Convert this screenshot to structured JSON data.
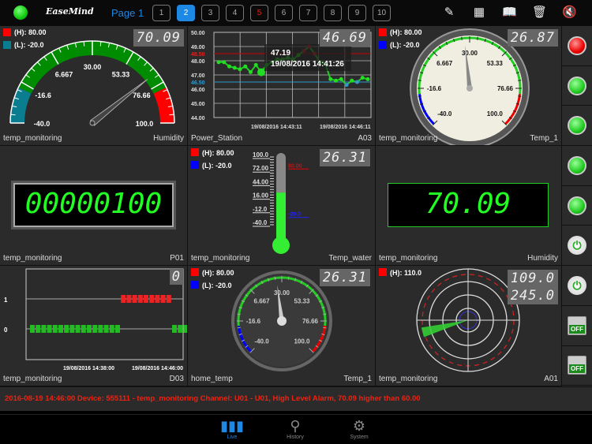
{
  "topbar": {
    "logo": "EaseMind",
    "page_label": "Page 1",
    "pages": [
      "1",
      "2",
      "3",
      "4",
      "5",
      "6",
      "7",
      "8",
      "9",
      "10"
    ],
    "active_page": "2",
    "alarm_page": "5",
    "tools": [
      "edit-icon",
      "grid-icon",
      "book-icon",
      "trash-icon",
      "mute-icon"
    ]
  },
  "panels": {
    "humidity_gauge": {
      "high": "(H): 80.00",
      "low": "(L): -20.0",
      "value": "70.09",
      "ticks": [
        "-40.0",
        "-16.6",
        "6.667",
        "30.00",
        "53.33",
        "76.66",
        "100.0"
      ],
      "device": "temp_monitoring",
      "channel": "Humidity",
      "reading": 70.09,
      "min": -40,
      "max": 100
    },
    "power_chart": {
      "value": "46.69",
      "device": "Power_Station",
      "channel": "A03",
      "tooltip_value": "47.19",
      "tooltip_time": "19/08/2016 14:41:26"
    },
    "temp1_dial": {
      "high": "(H): 80.00",
      "low": "(L): -20.0",
      "value": "26.87",
      "ticks": [
        "-40.0",
        "-16.6",
        "6.667",
        "30.00",
        "53.33",
        "76.66",
        "100.0"
      ],
      "device": "temp_monitoring",
      "channel": "Temp_1",
      "reading": 26.87
    },
    "p01_counter": {
      "display": "00000100",
      "device": "temp_monitoring",
      "channel": "P01"
    },
    "thermometer": {
      "high": "(H): 80.00",
      "low": "(L): -20.0",
      "value": "26.31",
      "scale": [
        "100.0",
        "72.00",
        "44.00",
        "16.00",
        "-12.0",
        "-40.0"
      ],
      "high_mark": "80.00",
      "low_mark": "-20.0",
      "device": "temp_monitoring",
      "channel": "Temp_water",
      "reading": 26.31
    },
    "humidity_display": {
      "display": "70.09",
      "device": "temp_monitoring",
      "channel": "Humidity"
    },
    "d03_chart": {
      "value": "0",
      "y_labels": [
        "1",
        "0"
      ],
      "x_labels": [
        "19/08/2016 14:38:00",
        "19/08/2016 14:46:00"
      ],
      "device": "temp_monitoring",
      "channel": "D03"
    },
    "temp1_dark_dial": {
      "high": "(H): 80.00",
      "low": "(L): -20.0",
      "value": "26.31",
      "ticks": [
        "-40.0",
        "-16.6",
        "6.667",
        "30.00",
        "53.33",
        "76.66",
        "100.0"
      ],
      "device": "home_temp",
      "channel": "Temp_1",
      "reading": 26.31
    },
    "radar": {
      "high": "(H): 110.0",
      "value1": "109.0",
      "value2": "245.0",
      "device": "temp_monitoring",
      "channel": "A01",
      "direction_deg": 245
    }
  },
  "chart_data": [
    {
      "type": "line",
      "title": "Power_Station A03",
      "ylim": [
        44,
        50
      ],
      "yticks": [
        "50.00",
        "49.00",
        "48.50",
        "48.00",
        "47.00",
        "46.50",
        "46.00",
        "45.00",
        "44.00"
      ],
      "high_limit": 48.5,
      "low_limit": 46.5,
      "x_labels": [
        "19/08/2016 14:43:11",
        "19/08/2016 14:46:11"
      ],
      "values": [
        47.9,
        47.9,
        47.6,
        47.5,
        47.4,
        47.6,
        47.2,
        47.7,
        47.19,
        47.7,
        47.9,
        48.1,
        48.1,
        48.2,
        48.1,
        48.4,
        48.7,
        49.0,
        48.5,
        47.9,
        47.8,
        46.7,
        46.6,
        46.7,
        46.3,
        46.6,
        46.5,
        46.8,
        46.7
      ]
    },
    {
      "type": "scatter",
      "title": "D03 digital",
      "ylim": [
        0,
        1
      ],
      "values": [
        0,
        0,
        0,
        0,
        0,
        0,
        0,
        0,
        0,
        0,
        0,
        0,
        0,
        0,
        0,
        0,
        1,
        1,
        1,
        1,
        1,
        1,
        1,
        1,
        1,
        0,
        0,
        0
      ]
    }
  ],
  "side_buttons": [
    "red",
    "green",
    "green",
    "green",
    "green",
    "power",
    "power",
    "off",
    "off"
  ],
  "off_label": "OFF",
  "alarm": "2016-08-19 14:46:00 Device: 555111 - temp_monitoring   Channel: U01 - U01, High Level Alarm, 70.09 higher than 60.00",
  "tabs": [
    {
      "label": "Live",
      "icon": "bar-chart-icon"
    },
    {
      "label": "History",
      "icon": "search-icon"
    },
    {
      "label": "System",
      "icon": "gear-icon"
    }
  ],
  "colors": {
    "accent": "#1e88e5",
    "alarm": "#ee2211",
    "ok": "#22cc22"
  }
}
